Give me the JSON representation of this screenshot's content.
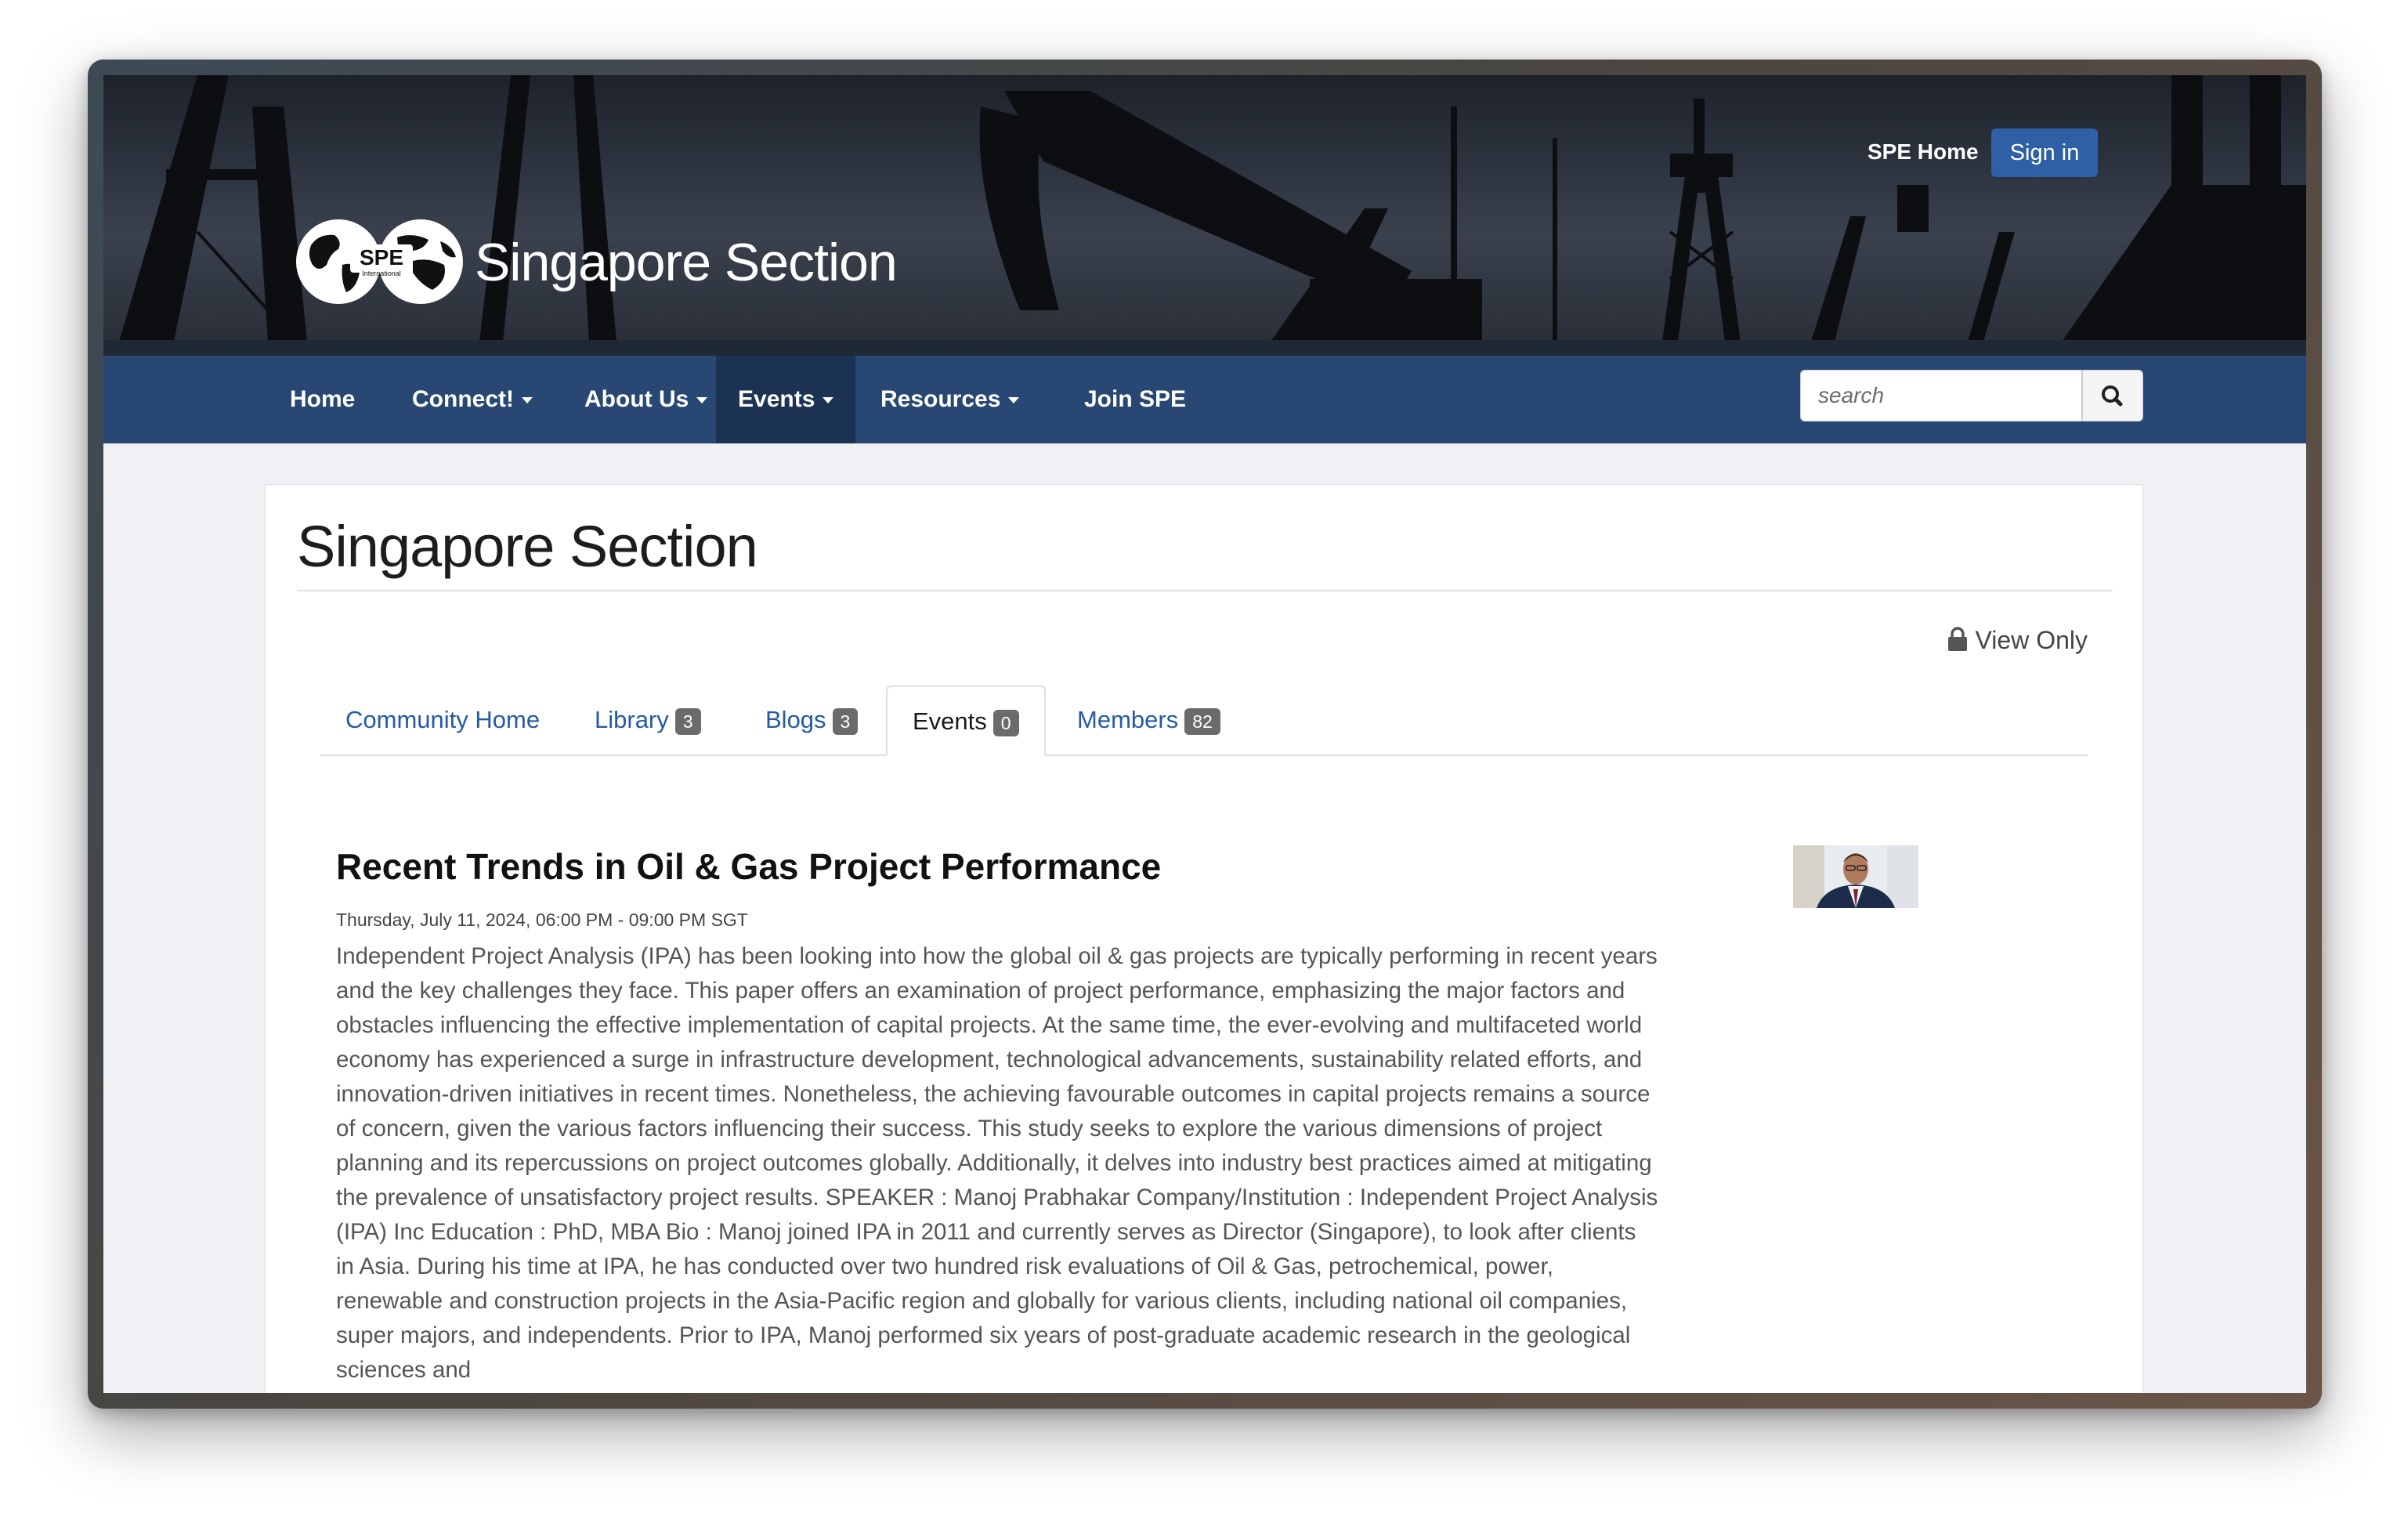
{
  "header": {
    "logo_text": "SPE International",
    "site_name": "Singapore Section",
    "spe_home_label": "SPE Home",
    "signin_label": "Sign in"
  },
  "nav": {
    "items": [
      {
        "label": "Home",
        "has_dropdown": false,
        "active": false
      },
      {
        "label": "Connect!",
        "has_dropdown": true,
        "active": false
      },
      {
        "label": "About Us",
        "has_dropdown": true,
        "active": false
      },
      {
        "label": "Events",
        "has_dropdown": true,
        "active": true
      },
      {
        "label": "Resources",
        "has_dropdown": true,
        "active": false
      },
      {
        "label": "Join SPE",
        "has_dropdown": false,
        "active": false
      }
    ],
    "search_placeholder": "search",
    "search_icon": "search-icon"
  },
  "main": {
    "page_title": "Singapore Section",
    "view_only_label": "View Only",
    "tabs": [
      {
        "label": "Community Home",
        "count": null,
        "active": false
      },
      {
        "label": "Library",
        "count": "3",
        "active": false
      },
      {
        "label": "Blogs",
        "count": "3",
        "active": false
      },
      {
        "label": "Events",
        "count": "0",
        "active": true
      },
      {
        "label": "Members",
        "count": "82",
        "active": false
      }
    ],
    "event": {
      "title": "Recent Trends in Oil & Gas Project Performance",
      "datetime": "Thursday, July 11, 2024, 06:00 PM - 09:00 PM SGT",
      "description": "Independent Project Analysis (IPA) has been looking into how the global oil & gas projects are typically performing in recent years and the key challenges they face. This paper offers an examination of project performance, emphasizing the major factors and obstacles influencing the effective implementation of capital projects. At the same time, the ever-evolving and multifaceted world economy has experienced a surge in infrastructure development, technological advancements, sustainability related efforts, and innovation-driven initiatives in recent times. Nonetheless, the achieving favourable outcomes in capital projects remains a source of concern, given the various factors influencing their success. This study seeks to explore the various dimensions of project planning and its repercussions on project outcomes globally. Additionally, it delves into industry best practices aimed at mitigating the prevalence of unsatisfactory project results. SPEAKER : Manoj Prabhakar Company/Institution : Independent Project Analysis (IPA) Inc Education : PhD, MBA Bio : Manoj joined IPA in 2011 and currently serves as Director (Singapore), to look after clients in Asia. During his time at IPA, he has conducted over two hundred risk evaluations of Oil & Gas, petrochemical, power, renewable and construction projects in the Asia-Pacific region and globally for various clients, including national oil companies, super majors, and independents. Prior to IPA, Manoj performed six years of post-graduate academic research in the geological sciences and"
    }
  },
  "colors": {
    "navbar": "#284873",
    "navbar_active": "#1c3252",
    "signin_button": "#2f5fa4",
    "link": "#245aa7",
    "badge": "#6b6b6b"
  }
}
